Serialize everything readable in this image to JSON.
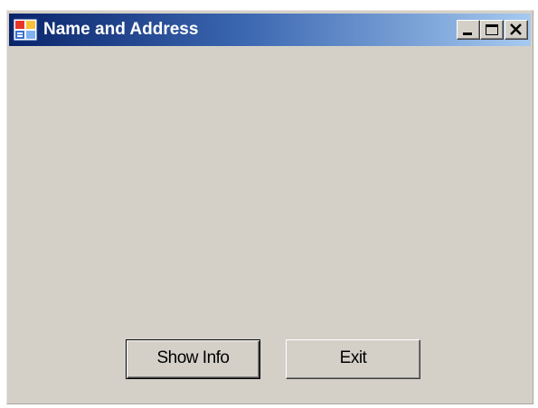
{
  "window": {
    "title": "Name and Address",
    "icon": "form-window-icon",
    "controls": {
      "minimize": "minimize-icon",
      "maximize": "maximize-icon",
      "close": "close-icon"
    }
  },
  "buttons": {
    "show_info": "Show Info",
    "exit": "Exit"
  },
  "colors": {
    "form_background": "#d4d0c8",
    "titlebar_start": "#0a246a",
    "titlebar_end": "#a6caf0",
    "title_text": "#ffffff"
  }
}
